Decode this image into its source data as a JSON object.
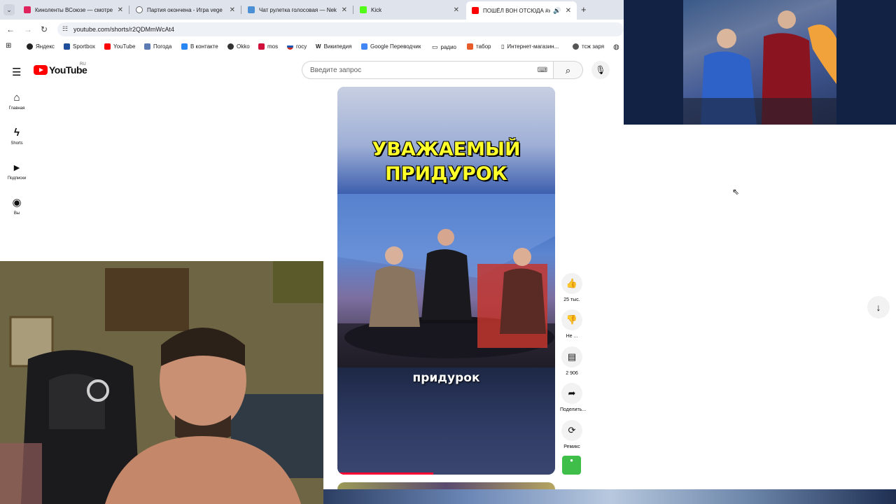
{
  "browser": {
    "tabs": [
      {
        "title": "Киноленты ВСоюзе — смотре",
        "favicon_color": "#e0245e",
        "active": false
      },
      {
        "title": "Партия окончена - Игра vege",
        "favicon_color": "#5f6368",
        "active": false
      },
      {
        "title": "Чат рулетка голосовая — Nek",
        "favicon_color": "#4b8fd4",
        "active": false
      },
      {
        "title": "Kick",
        "favicon_color": "#53fc18",
        "active": false
      },
      {
        "title": "ПОШЁЛ ВОН ОТСЮДА #ж",
        "favicon_color": "#ff0000",
        "active": true
      }
    ],
    "close_glyph": "✕",
    "new_tab_glyph": "+",
    "address": "youtube.com/shorts/r2QDMmWcAt4",
    "bookmarks": [
      {
        "label": "Яндекс",
        "color": "#222222"
      },
      {
        "label": "Sportbox",
        "color": "#1f4e9a"
      },
      {
        "label": "YouTube",
        "color": "#ff0000"
      },
      {
        "label": "Погода",
        "color": "#5b7bb2"
      },
      {
        "label": "В контакте",
        "color": "#2787f5"
      },
      {
        "label": "Okko",
        "color": "#333333"
      },
      {
        "label": "mos",
        "color": "#d0103a"
      },
      {
        "label": "госу",
        "color": "#1a56b3"
      },
      {
        "label": "Википедия",
        "color": "#444444"
      },
      {
        "label": "Google Переводчик",
        "color": "#4285f4"
      },
      {
        "label": "радио",
        "color": "#666666"
      },
      {
        "label": "табор",
        "color": "#e85c2c"
      },
      {
        "label": "Интернет-магазин...",
        "color": "#444444"
      },
      {
        "label": "тсж заря",
        "color": "#555555"
      }
    ]
  },
  "youtube": {
    "logo_text": "YouTube",
    "logo_region": "RU",
    "search_placeholder": "Введите запрос",
    "sidebar": [
      {
        "label": "Главная",
        "icon": "home-icon",
        "glyph": "⌂"
      },
      {
        "label": "Shorts",
        "icon": "shorts-icon",
        "glyph": "ϟ"
      },
      {
        "label": "Подписки",
        "icon": "subscriptions-icon",
        "glyph": "▶"
      },
      {
        "label": "Вы",
        "icon": "account-icon",
        "glyph": "◉"
      }
    ],
    "video": {
      "title_line1": "УВАЖАЕМЫЙ",
      "title_line2": "ПРИДУРОК",
      "subtitle": "придурок",
      "progress": 0.44
    },
    "actions": [
      {
        "label": "25 тыс.",
        "icon": "like-icon",
        "glyph": "👍"
      },
      {
        "label": "Не ...",
        "icon": "dislike-icon",
        "glyph": "👎"
      },
      {
        "label": "2 906",
        "icon": "comments-icon",
        "glyph": "▤"
      },
      {
        "label": "Поделить...",
        "icon": "share-icon",
        "glyph": "➦"
      },
      {
        "label": "Ремикс",
        "icon": "remix-icon",
        "glyph": "⟳"
      }
    ]
  }
}
